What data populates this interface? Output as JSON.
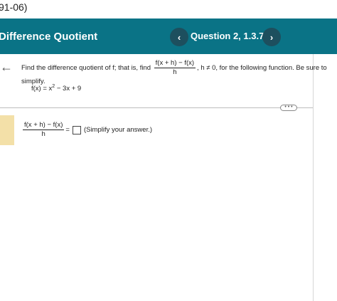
{
  "top": {
    "code": "91-06)"
  },
  "header": {
    "title": "Difference Quotient",
    "prev": "‹",
    "next": "›",
    "question_label": "Question 2, 1.3.77"
  },
  "question": {
    "prompt_start": "Find the difference quotient of f; that is, find",
    "frac_num": "f(x + h) − f(x)",
    "frac_den": "h",
    "prompt_end": ", h ≠ 0, for the following function.  Be sure to simplify.",
    "func_left": "f(x) = x",
    "func_exp": "2",
    "func_right": " − 3x + 9"
  },
  "more_button": "• • •",
  "answer": {
    "frac_num": "f(x + h) − f(x)",
    "frac_den": "h",
    "equals": "=",
    "hint": "(Simplify your answer.)"
  },
  "icons": {
    "back": "arrow-left-icon"
  }
}
